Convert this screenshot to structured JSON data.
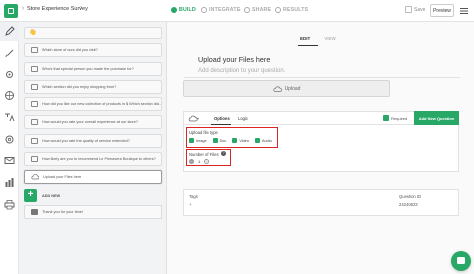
{
  "app": {
    "survey_title": "Store Experience Survey",
    "crumb_sep": "›",
    "title_chevron": "›"
  },
  "steps": [
    {
      "label": "BUILD",
      "active": true
    },
    {
      "label": "INTEGRATE",
      "active": false
    },
    {
      "label": "SHARE",
      "active": false
    },
    {
      "label": "RESULTS",
      "active": false
    }
  ],
  "step_separator": "›",
  "toolbar": {
    "save_label": "Save",
    "preview_label": "Preview"
  },
  "rail_icons": [
    "pencil-icon",
    "brush-icon",
    "gear-icon",
    "globe-icon",
    "translate-icon",
    "settings-icon",
    "mail-icon",
    "chart-icon",
    "print-icon"
  ],
  "welcome_icon": "👋",
  "questions": [
    {
      "icon": "text-icon",
      "text": "Which store of ours did you visit?"
    },
    {
      "icon": "text-icon",
      "text": "Who's that special person you made the purchase for?"
    },
    {
      "icon": "text-icon",
      "text": "Which section did you enjoy shopping from?"
    },
    {
      "icon": "text-icon",
      "text": "How did you like our new collection of products in $ Which section did..."
    },
    {
      "icon": "text-icon",
      "text": "How would you rate your overall experience at our store?"
    },
    {
      "icon": "text-icon",
      "text": "How would you rate the quality of service extended?"
    },
    {
      "icon": "text-icon",
      "text": "How likely are you to recommend Le Primavera Boutique to others?"
    },
    {
      "icon": "upload-icon",
      "text": "Upload your Files here",
      "selected": true
    }
  ],
  "add_new_label": "ADD NEW",
  "thank_you": "Thank you for your time!",
  "editor": {
    "tabs": [
      "EDIT",
      "VIEW"
    ],
    "question_title": "Upload your Files here",
    "description_placeholder": "Add description to your question.",
    "upload_label": "Upload",
    "options_tabs": [
      "Options",
      "Logic"
    ],
    "required_label": "Required",
    "add_question_button": "Add New Question",
    "file_type_label": "Upload file type",
    "file_types": [
      "Image",
      "Doc",
      "Video",
      "Audio"
    ],
    "number_of_files_label": "Number of Files",
    "number_of_files_value": "1",
    "tags_label": "Tags",
    "tags_value": "+",
    "question_id_label": "Question ID",
    "question_id_value": "24240623",
    "help_glyph": "?",
    "minus_glyph": "−",
    "plus_glyph": "+",
    "required_checked": true
  },
  "colors": {
    "accent": "#27a867",
    "highlight": "#d92525"
  }
}
